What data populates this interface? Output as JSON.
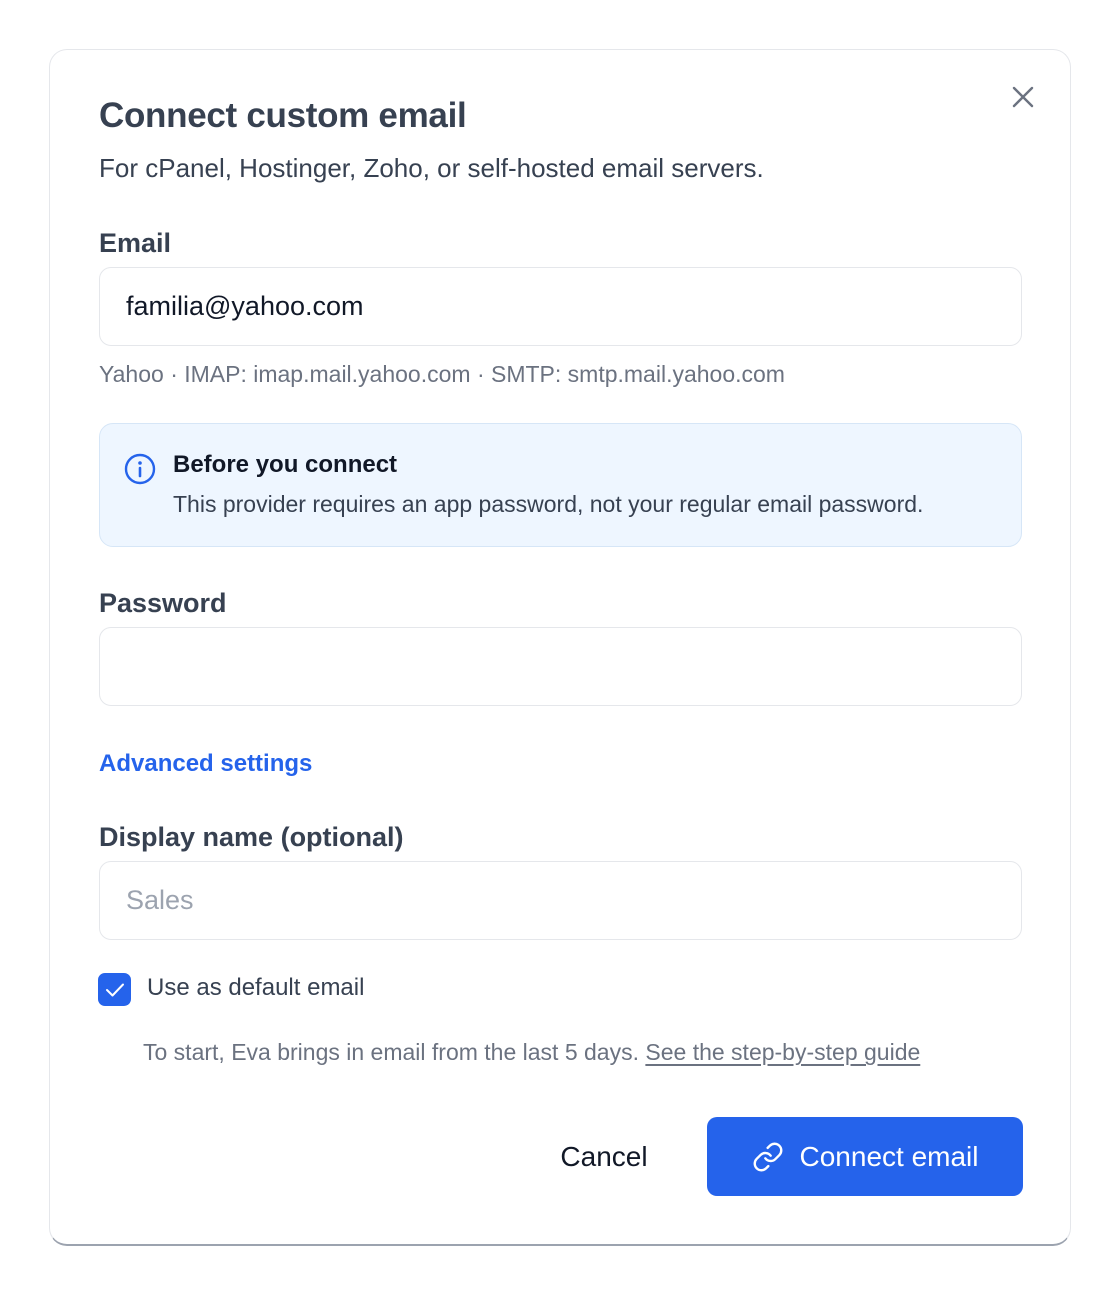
{
  "dialog": {
    "title": "Connect custom email",
    "subtitle": "For cPanel, Hostinger, Zoho, or self-hosted email servers.",
    "close_icon": "close-icon"
  },
  "email": {
    "label": "Email",
    "value": "familia@yahoo.com",
    "hint": "Yahoo · IMAP: imap.mail.yahoo.com · SMTP: smtp.mail.yahoo.com"
  },
  "notice": {
    "icon": "info-icon",
    "title": "Before you connect",
    "body": "This provider requires an app password, not your regular email password."
  },
  "password": {
    "label": "Password",
    "value": ""
  },
  "advanced_settings_label": "Advanced settings",
  "display_name": {
    "label": "Display name (optional)",
    "placeholder": "Sales"
  },
  "default_email": {
    "label": "Use as default email",
    "checked": true
  },
  "footnote": {
    "text": "To start, Eva brings in email from the last 5 days.",
    "link": "See the step-by-step guide"
  },
  "actions": {
    "cancel_label": "Cancel",
    "connect_label": "Connect email",
    "connect_icon": "link-icon"
  },
  "colors": {
    "accent": "#2563eb",
    "notice_bg": "#eef6ff"
  }
}
